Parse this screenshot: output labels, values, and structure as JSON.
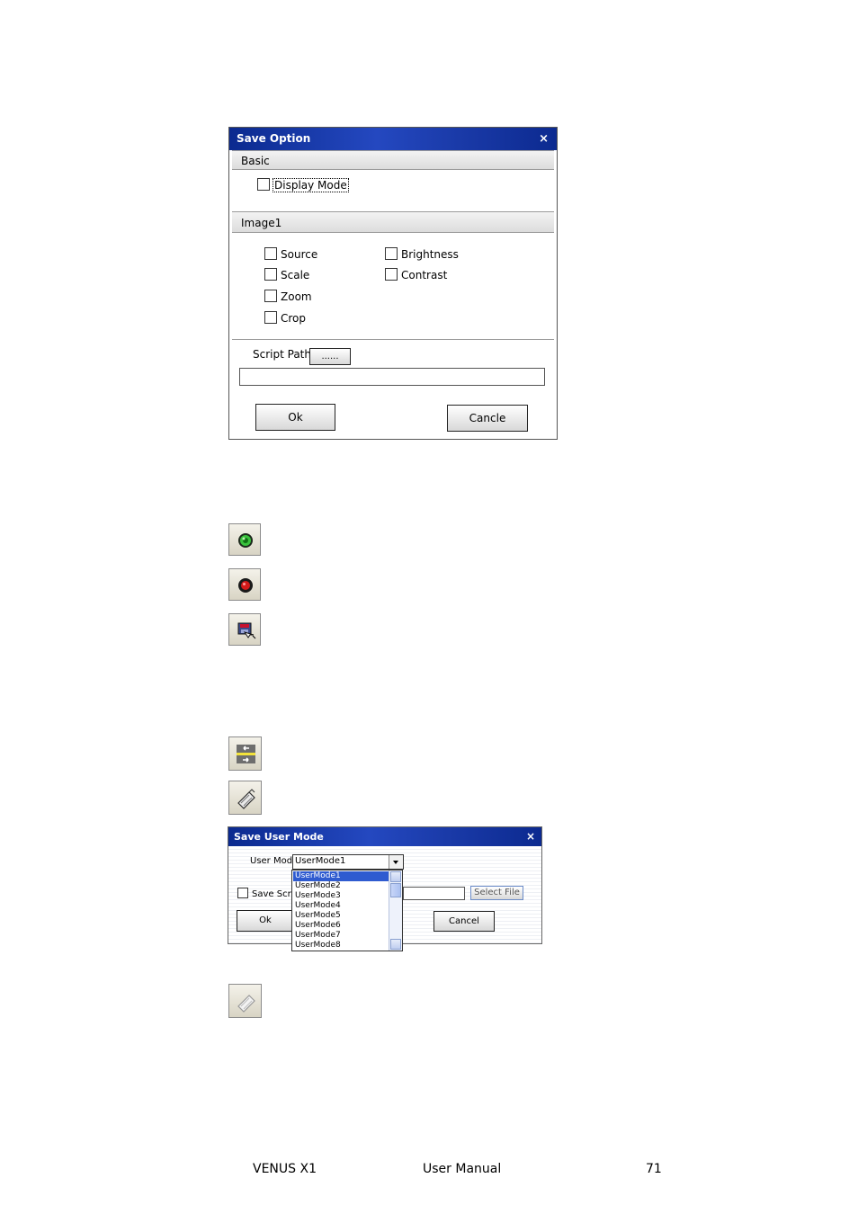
{
  "save_option_dialog": {
    "title": "Save Option",
    "close_glyph": "×",
    "basic_section": "Basic",
    "display_mode": "Display Mode",
    "image_section": "Image1",
    "checkboxes_left": [
      "Source",
      "Scale",
      "Zoom",
      "Crop"
    ],
    "checkboxes_right": [
      "Brightness",
      "Contrast"
    ],
    "script_path_label": "Script Path",
    "browse_button": "......",
    "ok_button": "Ok",
    "cancel_button": "Cancle"
  },
  "icons": [
    "green-record-icon",
    "red-record-icon",
    "save-script-icon",
    "swap-arrows-icon",
    "save-user-mode-icon",
    "load-user-mode-icon"
  ],
  "save_user_mode_dialog": {
    "title": "Save User Mode",
    "close_glyph": "×",
    "user_mode_label": "User Mode",
    "selected_mode": "UserMode1",
    "options": [
      "UserMode1",
      "UserMode2",
      "UserMode3",
      "UserMode4",
      "UserMode5",
      "UserMode6",
      "UserMode7",
      "UserMode8"
    ],
    "save_script_label": "Save Scrip",
    "select_file_button": "Select File",
    "ok_button": "Ok",
    "cancel_button": "Cancel"
  },
  "footer": {
    "product": "VENUS X1",
    "doc": "User Manual",
    "page": "71"
  },
  "colors": {
    "titlebar": "#1a3aa8",
    "selection": "#2f5bd0"
  }
}
